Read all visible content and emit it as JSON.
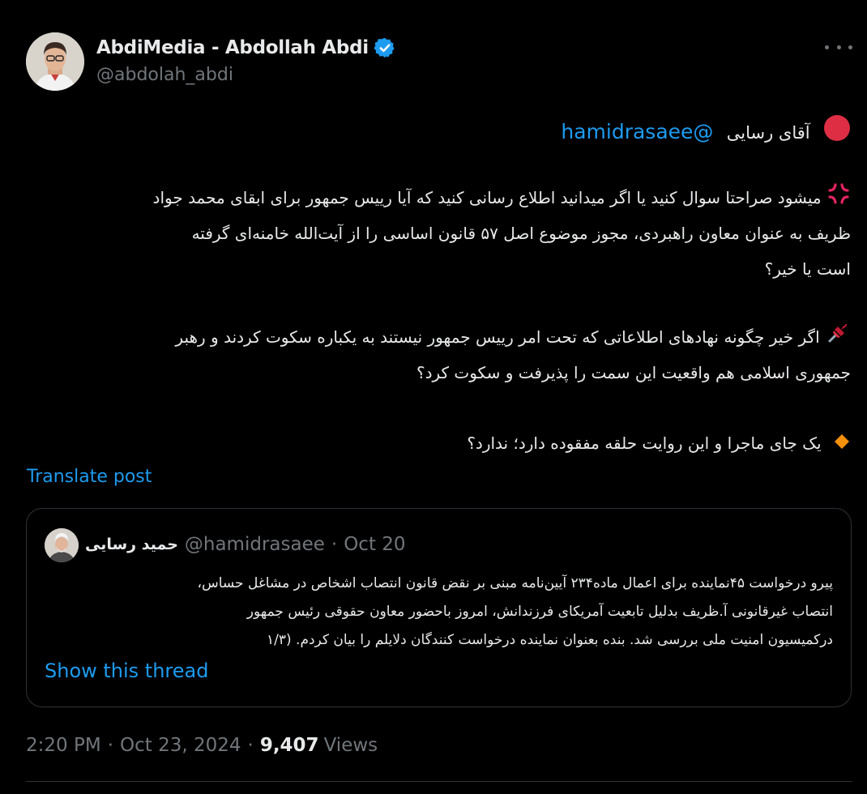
{
  "author": {
    "display_name": "AbdiMedia - Abdollah Abdi",
    "handle": "@abdolah_abdi",
    "verified": true
  },
  "tweet": {
    "mention_line": {
      "emoji": "red-circle-icon",
      "text": "آقای رسایی",
      "mention": "@hamidrasaee"
    },
    "paragraph1": [
      "میشود صراحتا سوال کنید یا اگر میدانید اطلاع رسانی کنید که آیا رییس جمهور برای ابقای محمد جواد",
      "ظریف به عنوان معاون راهبردی، مجوز موضوع اصل ۵۷ قانون اساسی را از آیت‌الله خامنه‌ای گرفته",
      "است یا خیر؟"
    ],
    "paragraph2": [
      "اگر خیر چگونه نهادهای اطلاعاتی که تحت امر رییس جمهور نیستند به یکباره سکوت کردند و رهبر",
      "جمهوری اسلامی هم واقعیت این سمت را پذیرفت و سکوت کرد؟"
    ],
    "paragraph3": "یک جای ماجرا و این روایت حلقه مفقوده دارد؛ ندارد؟",
    "translate_label": "Translate post"
  },
  "quoted": {
    "name": "حمید رسایی",
    "handle": "@hamidrasaee",
    "separator": "·",
    "date": "Oct 20",
    "lines": [
      "پیرو درخواست ۴۵نماینده برای اعمال ماده۲۳۴ آیین‌نامه مبنی بر نقض قانون انتصاب اشخاص در مشاغل حساس،",
      "انتصاب غیرقانونی آ.ظریف بدلیل تابعیت آمریکای فرزندانش، امروز باحضور معاون حقوقی رئیس جمهور",
      "درکمیسیون امنیت ملی بررسی شد. بنده بعنوان نماینده درخواست کنندگان دلایلم را بیان کردم. (۱/۳"
    ],
    "show_thread_label": "Show this thread"
  },
  "footer": {
    "time": "2:20 PM",
    "separator": "·",
    "date": "Oct 23, 2024",
    "views_count": "9,407",
    "views_label": "Views"
  },
  "colors": {
    "background": "#000000",
    "text": "#e7e9ea",
    "muted": "#71767b",
    "accent": "#1d9bf0",
    "border": "#2f3336"
  }
}
